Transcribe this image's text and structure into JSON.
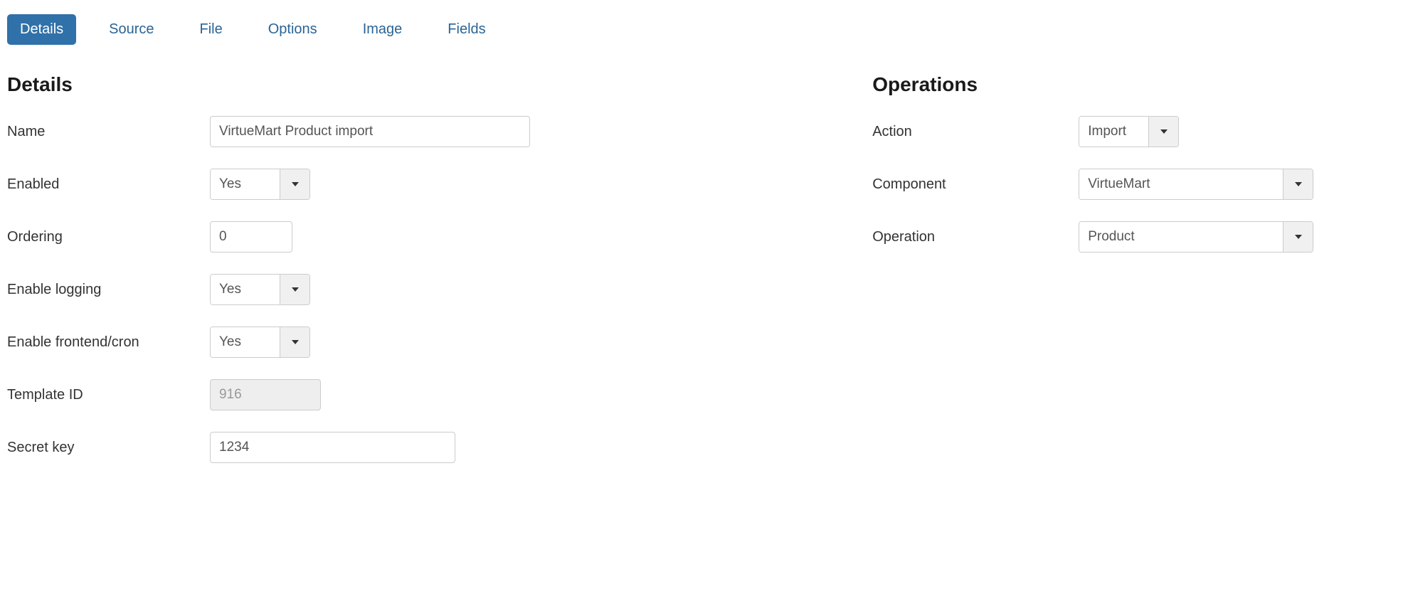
{
  "tabs": [
    {
      "label": "Details",
      "active": true
    },
    {
      "label": "Source",
      "active": false
    },
    {
      "label": "File",
      "active": false
    },
    {
      "label": "Options",
      "active": false
    },
    {
      "label": "Image",
      "active": false
    },
    {
      "label": "Fields",
      "active": false
    }
  ],
  "details": {
    "heading": "Details",
    "name_label": "Name",
    "name_value": "VirtueMart Product import",
    "enabled_label": "Enabled",
    "enabled_value": "Yes",
    "ordering_label": "Ordering",
    "ordering_value": "0",
    "logging_label": "Enable logging",
    "logging_value": "Yes",
    "frontend_label": "Enable frontend/cron",
    "frontend_value": "Yes",
    "template_id_label": "Template ID",
    "template_id_value": "916",
    "secret_key_label": "Secret key",
    "secret_key_value": "1234"
  },
  "operations": {
    "heading": "Operations",
    "action_label": "Action",
    "action_value": "Import",
    "component_label": "Component",
    "component_value": "VirtueMart",
    "operation_label": "Operation",
    "operation_value": "Product"
  }
}
